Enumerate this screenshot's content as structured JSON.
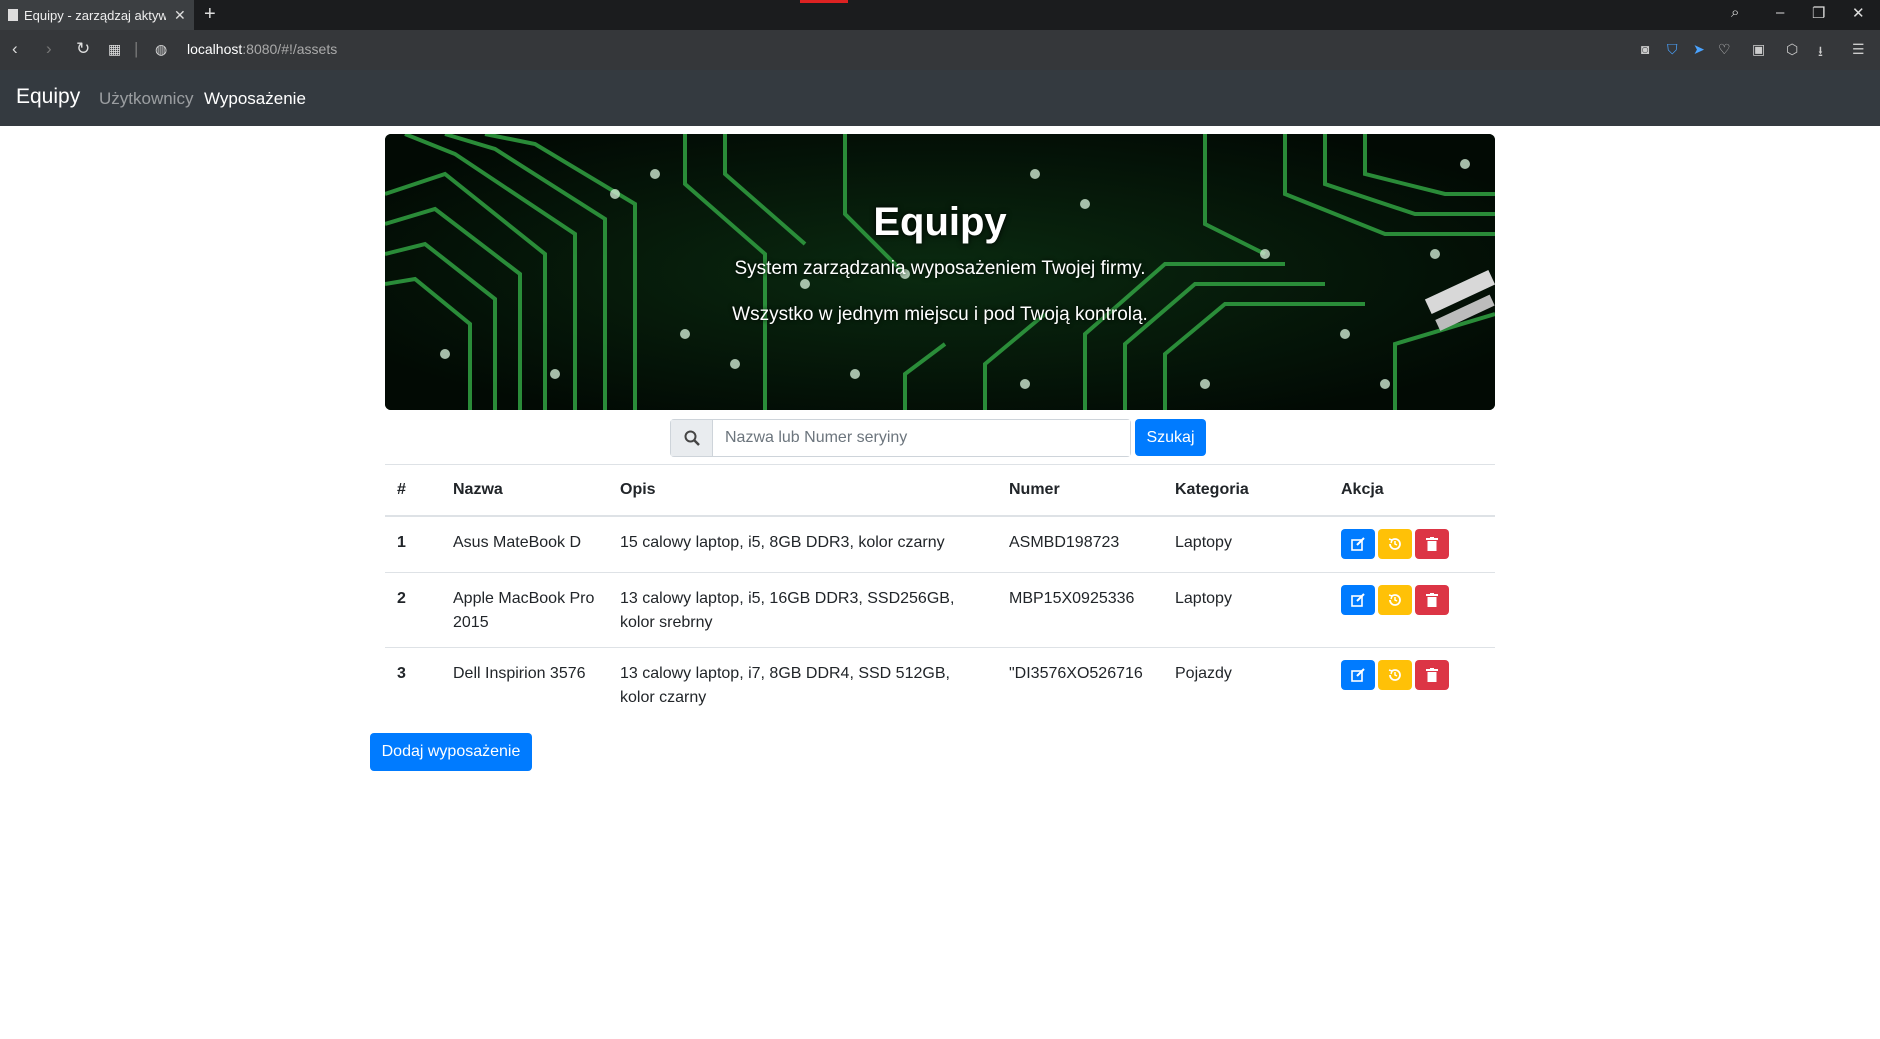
{
  "browser": {
    "tab_title": "Equipy - zarządzaj aktywami",
    "url_host": "localhost",
    "url_rest": ":8080/#!/assets"
  },
  "navbar": {
    "brand": "Equipy",
    "links": [
      {
        "label": "Użytkownicy",
        "active": false
      },
      {
        "label": "Wyposażenie",
        "active": true
      }
    ]
  },
  "hero": {
    "title": "Equipy",
    "line1": "System zarządzania wyposażeniem Twojej firmy.",
    "line2": "Wszystko w jednym miejscu i pod Twoją kontrolą."
  },
  "search": {
    "placeholder": "Nazwa lub Numer seryiny",
    "button": "Szukaj"
  },
  "table": {
    "headers": [
      "#",
      "Nazwa",
      "Opis",
      "Numer",
      "Kategoria",
      "Akcja"
    ],
    "rows": [
      {
        "n": "1",
        "name": "Asus MateBook D",
        "desc": "15 calowy laptop, i5, 8GB DDR3, kolor czarny",
        "serial": "ASMBD198723",
        "category": "Laptopy"
      },
      {
        "n": "2",
        "name": "Apple MacBook Pro 2015",
        "desc": "13 calowy laptop, i5, 16GB DDR3, SSD256GB, kolor srebrny",
        "serial": "MBP15X0925336",
        "category": "Laptopy"
      },
      {
        "n": "3",
        "name": "Dell Inspirion 3576",
        "desc": "13 calowy laptop, i7, 8GB DDR4, SSD 512GB, kolor czarny",
        "serial": "\"DI3576XO526716",
        "category": "Pojazdy"
      }
    ]
  },
  "add_button": "Dodaj wyposażenie",
  "colors": {
    "primary": "#007bff",
    "warning": "#ffc107",
    "danger": "#dc3545",
    "navbar": "#343a40"
  }
}
